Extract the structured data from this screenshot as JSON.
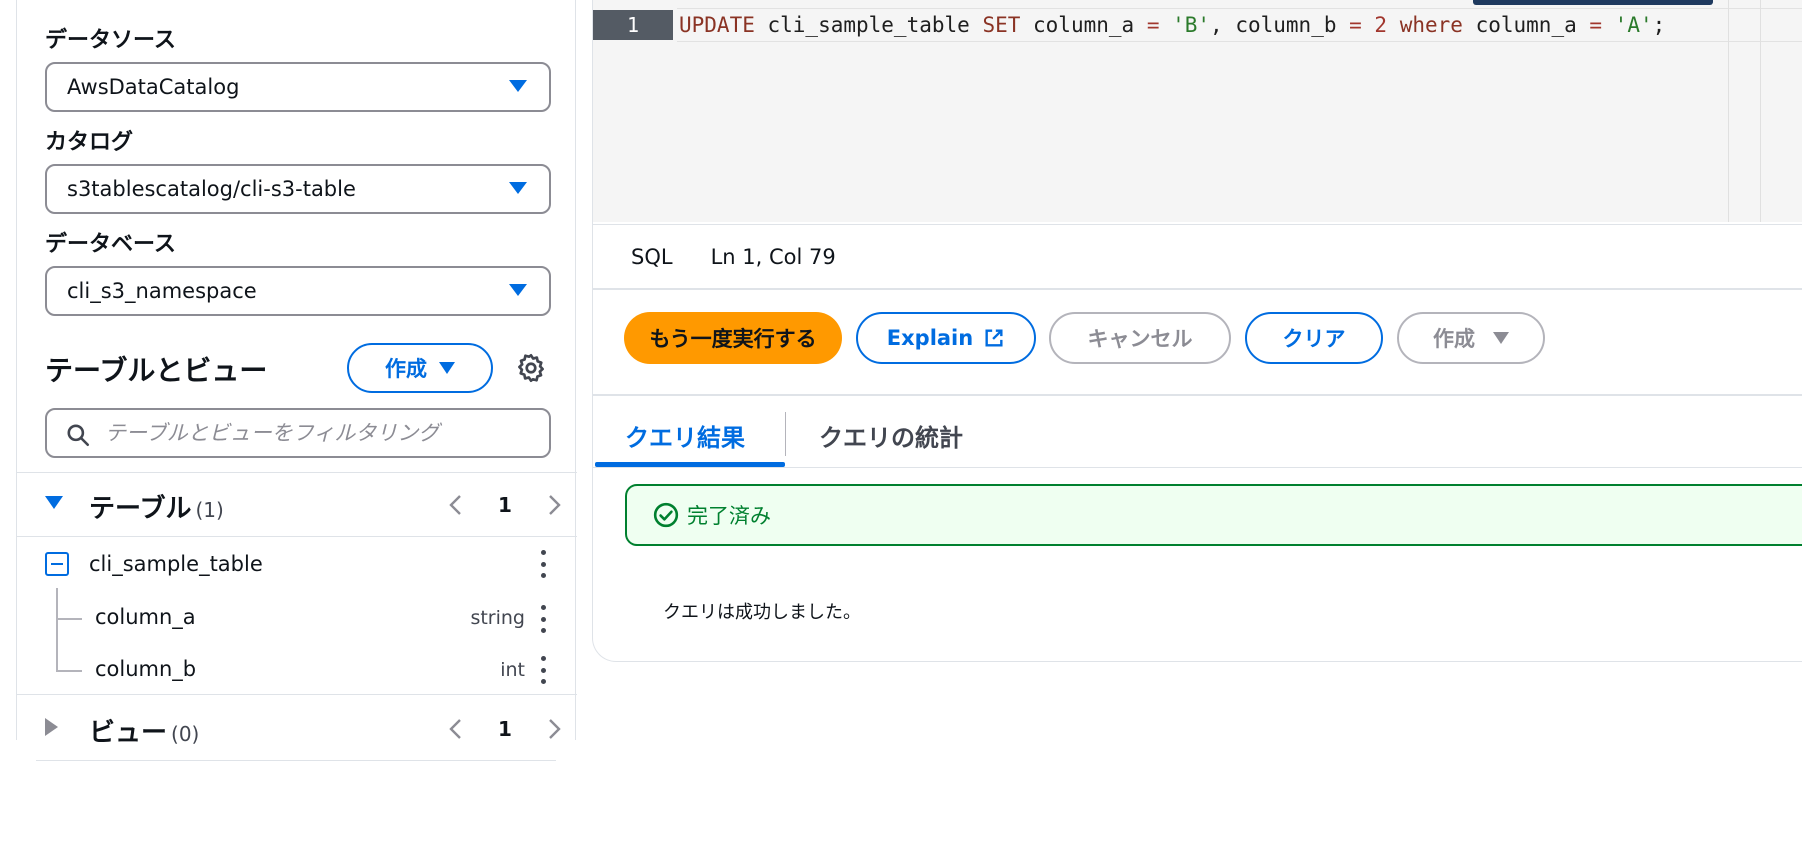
{
  "left_panel": {
    "datasource_label": "データソース",
    "datasource_value": "AwsDataCatalog",
    "catalog_label": "カタログ",
    "catalog_value": "s3tablescatalog/cli-s3-table",
    "database_label": "データベース",
    "database_value": "cli_s3_namespace",
    "tables_views_title": "テーブルとビュー",
    "create_label": "作成",
    "filter_placeholder": "テーブルとビューをフィルタリング",
    "tables_group": {
      "label": "テーブル",
      "count": "(1)",
      "page": "1"
    },
    "views_group": {
      "label": "ビュー",
      "count": "(0)",
      "page": "1"
    },
    "table": {
      "name": "cli_sample_table",
      "columns": [
        {
          "name": "column_a",
          "type": "string"
        },
        {
          "name": "column_b",
          "type": "int"
        }
      ]
    }
  },
  "editor": {
    "line_number": "1",
    "tokens": {
      "kw_update": "UPDATE",
      "t1": " cli_sample_table ",
      "kw_set": "SET",
      "t2": " column_a ",
      "op1": "=",
      "s1": " 'B'",
      "t3": ", column_b ",
      "op2": "=",
      "n1": " 2",
      "kw_where": " where",
      "t4": " column_a ",
      "op3": "=",
      "s2": " 'A'",
      "t5": ";"
    }
  },
  "status": {
    "language": "SQL",
    "position": "Ln 1, Col 79"
  },
  "actions": {
    "run_again": "もう一度実行する",
    "explain": "Explain",
    "cancel": "キャンセル",
    "clear": "クリア",
    "create": "作成"
  },
  "tabs": {
    "results": "クエリ結果",
    "stats": "クエリの統計"
  },
  "result": {
    "status": "完了済み",
    "message": "クエリは成功しました。"
  },
  "colors": {
    "accent": "#006ce0",
    "primary_button": "#ff9900",
    "success": "#00802f"
  }
}
